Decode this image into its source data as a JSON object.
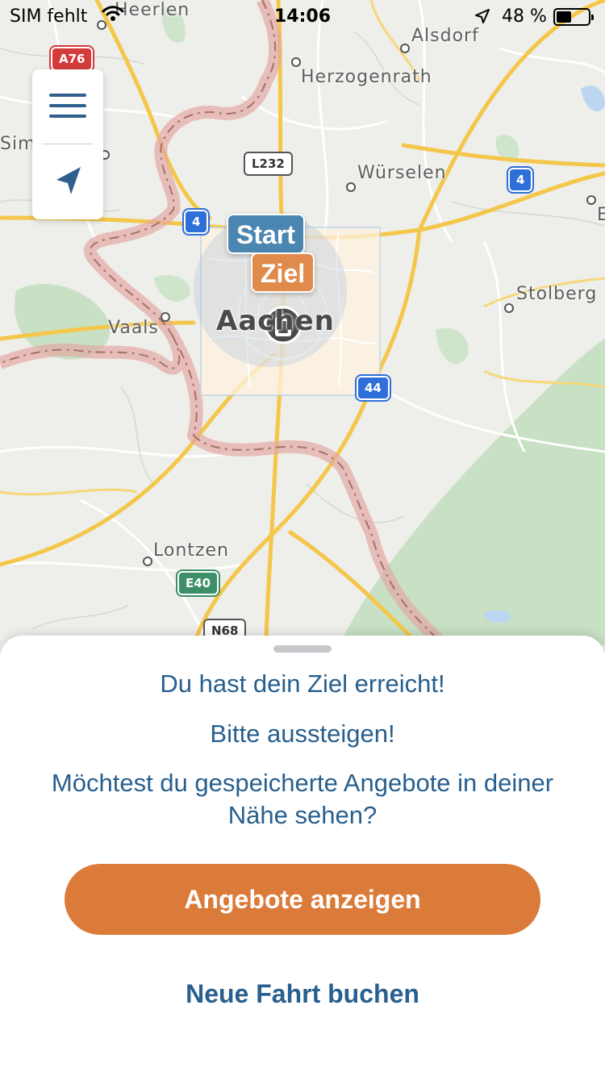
{
  "status_bar": {
    "carrier": "SIM fehlt",
    "time": "14:06",
    "battery_percent": "48 %",
    "battery_level": 0.48
  },
  "map": {
    "places": {
      "heerlen": "Heerlen",
      "alsdorf": "Alsdorf",
      "herzogenrath": "Herzogenrath",
      "wuerselen": "Würselen",
      "stolberg": "Stolberg",
      "vaals": "Vaals",
      "aachen": "Aachen",
      "lontzen": "Lontzen",
      "simp": "Simp",
      "e_edge": "E"
    },
    "shields": {
      "a76": "A76",
      "l232": "L232",
      "a4_west": "4",
      "a4_east": "4",
      "a44": "44",
      "e40": "E40",
      "n68": "N68"
    },
    "start_label": "Start",
    "ziel_label": "Ziel",
    "colors": {
      "border_line": "#e4a8a4",
      "motorway": "#f4c74a",
      "forest": "#c8e0c4"
    }
  },
  "sheet": {
    "title": "Du hast dein Ziel erreicht!",
    "subtitle": "Bitte aussteigen!",
    "question": "Möchtest du gespeicherte Angebote in deiner Nähe sehen?",
    "primary_button": "Angebote anzeigen",
    "secondary_button": "Neue Fahrt buchen"
  },
  "colors": {
    "accent": "#db7b39",
    "text_blue": "#285f8e",
    "start_pin": "#4a86b0",
    "ziel_pin": "#e08b4b"
  }
}
